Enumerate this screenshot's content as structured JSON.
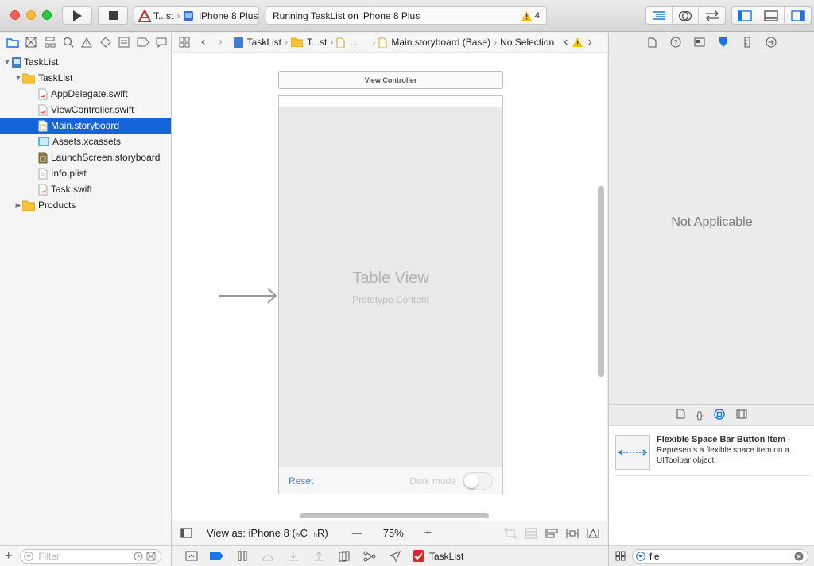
{
  "toolbar": {
    "scheme_target": "T...st",
    "scheme_device": "iPhone 8 Plus",
    "activity_status": "Running TaskList on iPhone 8 Plus",
    "warning_count": "4"
  },
  "navigator": {
    "items": [
      {
        "label": "TaskList",
        "level": 0,
        "kind": "project",
        "disclosure": "open"
      },
      {
        "label": "TaskList",
        "level": 1,
        "kind": "folder",
        "disclosure": "open"
      },
      {
        "label": "AppDelegate.swift",
        "level": 2,
        "kind": "swift"
      },
      {
        "label": "ViewController.swift",
        "level": 2,
        "kind": "swift"
      },
      {
        "label": "Main.storyboard",
        "level": 2,
        "kind": "storyboard",
        "selected": true
      },
      {
        "label": "Assets.xcassets",
        "level": 2,
        "kind": "assets"
      },
      {
        "label": "LaunchScreen.storyboard",
        "level": 2,
        "kind": "storyboard"
      },
      {
        "label": "Info.plist",
        "level": 2,
        "kind": "plist"
      },
      {
        "label": "Task.swift",
        "level": 2,
        "kind": "swift"
      },
      {
        "label": "Products",
        "level": 1,
        "kind": "folder",
        "disclosure": "closed"
      }
    ],
    "filter_placeholder": "Filter"
  },
  "jumpbar": {
    "project": "TaskList",
    "group": "T...st",
    "file_abbrev": "...",
    "file": "Main.storyboard (Base)",
    "selection": "No Selection"
  },
  "canvas": {
    "scene_title": "View Controller",
    "table_title": "Table View",
    "table_subtitle": "Prototype Content",
    "reset_label": "Reset",
    "dark_mode_label": "Dark mode",
    "dark_mode_on": false
  },
  "canvas_bottom": {
    "view_as_prefix": "View as: iPhone 8 (",
    "w_class": "w",
    "w_value": "C",
    "h_class": "h",
    "h_value": "R)",
    "zoom": "75%",
    "zoom_out": "—",
    "zoom_in": "+"
  },
  "debug": {
    "target": "TaskList"
  },
  "inspector": {
    "placeholder": "Not Applicable"
  },
  "library": {
    "item_title": "Flexible Space Bar Button Item",
    "item_title_dash": " -",
    "item_desc": "Represents a flexible space item on a UIToolbar object.",
    "search_value": "fle"
  },
  "colors": {
    "selection": "#1465d9",
    "accent_blue": "#1a73e8",
    "warning": "#f5c400",
    "link": "#3c88de"
  }
}
